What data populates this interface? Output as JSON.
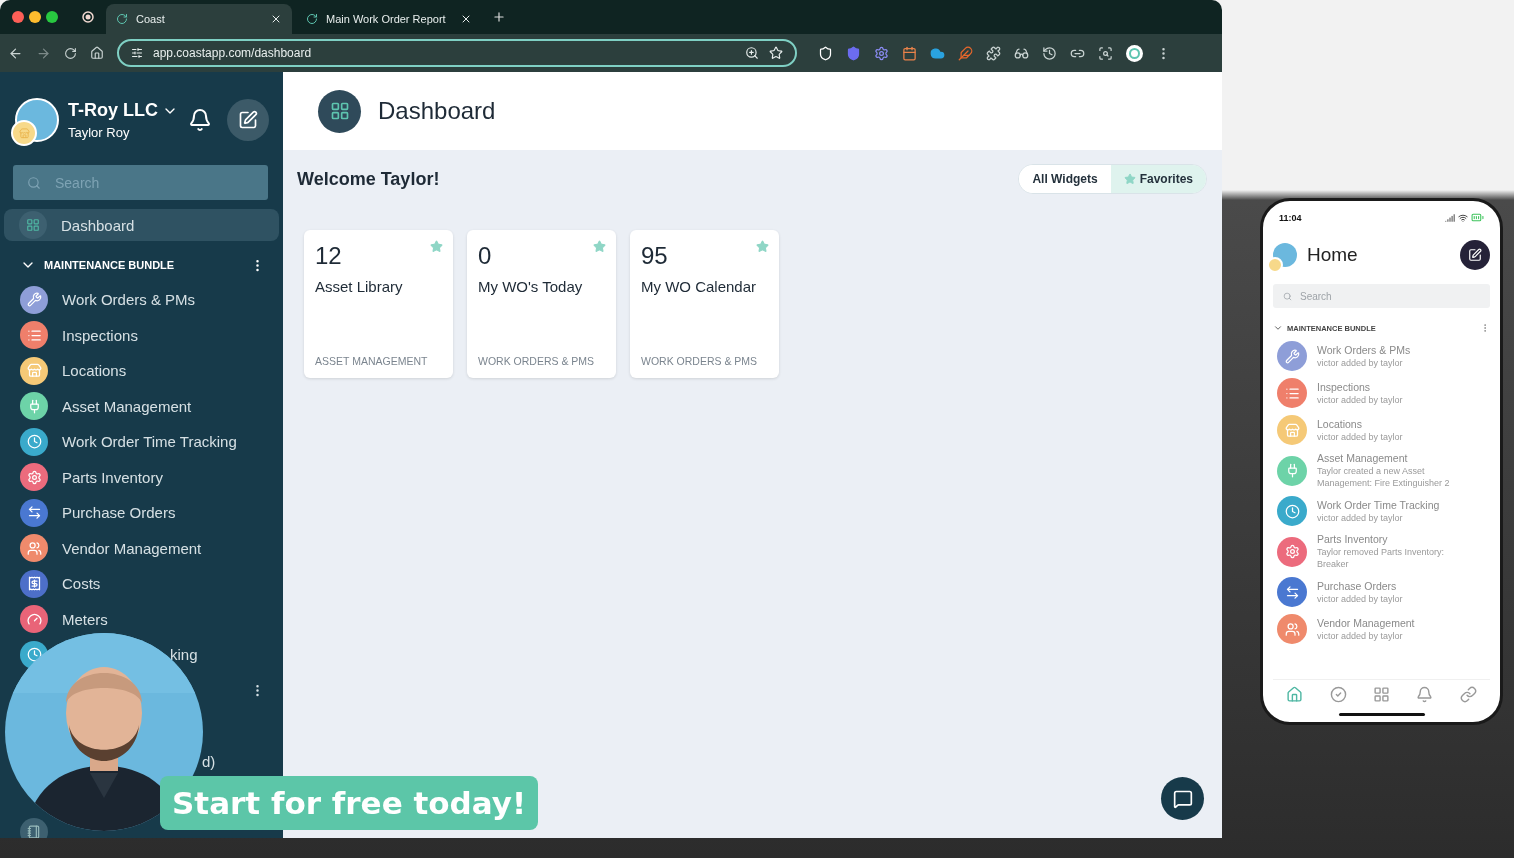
{
  "browser": {
    "tabs": [
      {
        "title": "Coast",
        "selected": true
      },
      {
        "title": "Main Work Order Report",
        "selected": false
      }
    ],
    "url": "app.coastapp.com/dashboard"
  },
  "sidebar": {
    "org": "T-Roy LLC",
    "user": "Taylor Roy",
    "search": {
      "placeholder": "Search"
    },
    "pinned": {
      "label": "Dashboard",
      "selected": true
    },
    "section": {
      "title": "MAINTENANCE BUNDLE",
      "expanded": true,
      "items": [
        {
          "label": "Work Orders & PMs",
          "color": "#8e9ed8",
          "selected": false
        },
        {
          "label": "Inspections",
          "color": "#ef7f6b",
          "selected": false
        },
        {
          "label": "Locations",
          "color": "#f5c977",
          "selected": false
        },
        {
          "label": "Asset Management",
          "color": "#6dd3a8",
          "selected": false
        },
        {
          "label": "Work Order Time Tracking",
          "color": "#3aaacb",
          "selected": false
        },
        {
          "label": "Parts Inventory",
          "color": "#ec6b7d",
          "selected": false
        },
        {
          "label": "Purchase Orders",
          "color": "#4a78d1",
          "selected": false
        },
        {
          "label": "Vendor Management",
          "color": "#ef8a6c",
          "selected": false
        },
        {
          "label": "Costs",
          "color": "#4d6fc9",
          "selected": false
        },
        {
          "label": "Meters",
          "color": "#e96478",
          "selected": false
        },
        {
          "label": "king",
          "color": "#3aaacb",
          "selected": false
        }
      ]
    },
    "more_items": [
      {
        "label": "d)"
      }
    ]
  },
  "main": {
    "title": "Dashboard",
    "welcome": "Welcome Taylor!",
    "filters": [
      {
        "label": "All Widgets",
        "selected": false
      },
      {
        "label": "Favorites",
        "selected": true
      }
    ],
    "widgets": [
      {
        "value": "12",
        "title": "Asset Library",
        "category": "ASSET MANAGEMENT",
        "favorite": true
      },
      {
        "value": "0",
        "title": "My WO's Today",
        "category": "WORK ORDERS & PMS",
        "favorite": true
      },
      {
        "value": "95",
        "title": "My WO Calendar",
        "category": "WORK ORDERS & PMS",
        "favorite": true
      }
    ]
  },
  "promo": {
    "banner": "Start for free today!"
  },
  "phone": {
    "time": "11:04",
    "title": "Home",
    "search": {
      "placeholder": "Search"
    },
    "section": "MAINTENANCE BUNDLE",
    "items": [
      {
        "name": "Work Orders & PMs",
        "activity": "victor added by taylor",
        "color": "#8e9ed8"
      },
      {
        "name": "Inspections",
        "activity": "victor added by taylor",
        "color": "#ef7f6b"
      },
      {
        "name": "Locations",
        "activity": "victor added by taylor",
        "color": "#f5c977"
      },
      {
        "name": "Asset Management",
        "activity": "Taylor created a new Asset Management: Fire Extinguisher 2",
        "color": "#6dd3a8"
      },
      {
        "name": "Work Order Time Tracking",
        "activity": "victor added by taylor",
        "color": "#3aaacb"
      },
      {
        "name": "Parts Inventory",
        "activity": "Taylor removed Parts Inventory: Breaker",
        "color": "#ec6b7d"
      },
      {
        "name": "Purchase Orders",
        "activity": "victor added by taylor",
        "color": "#4a78d1"
      },
      {
        "name": "Vendor Management",
        "activity": "victor added by taylor",
        "color": "#ef8a6c"
      }
    ],
    "nav": [
      {
        "selected": true
      },
      {
        "selected": false
      },
      {
        "selected": false
      },
      {
        "selected": false
      },
      {
        "selected": false
      }
    ]
  }
}
